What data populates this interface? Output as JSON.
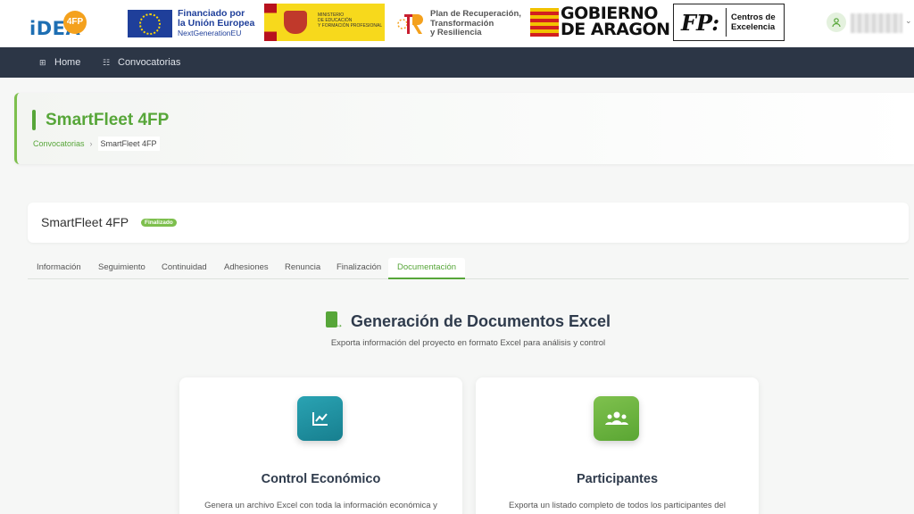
{
  "logos": {
    "idea_text": "iDEA",
    "idea_badge": "4FP",
    "eu_line1": "Financiado por",
    "eu_line2": "la Unión Europea",
    "eu_line3": "NextGenerationEU",
    "ministerio_line1": "MINISTERIO",
    "ministerio_line2": "DE EDUCACIÓN",
    "ministerio_line3": "Y FORMACIÓN PROFESIONAL",
    "prtr_line1": "Plan de Recuperación,",
    "prtr_line2": "Transformación",
    "prtr_line3": "y Resiliencia",
    "aragon_line1": "GOBIERNO",
    "aragon_line2": "DE ARAGON",
    "fp_mark": "FP:",
    "fp_line1": "Centros de",
    "fp_line2": "Excelencia"
  },
  "nav": {
    "home": "Home",
    "convocatorias": "Convocatorias"
  },
  "header": {
    "title": "SmartFleet 4FP",
    "breadcrumb_parent": "Convocatorias",
    "breadcrumb_current": "SmartFleet 4FP"
  },
  "project": {
    "title": "SmartFleet 4FP",
    "badge": "Finalizado"
  },
  "tabs": [
    {
      "label": "Información"
    },
    {
      "label": "Seguimiento"
    },
    {
      "label": "Continuidad"
    },
    {
      "label": "Adhesiones"
    },
    {
      "label": "Renuncia"
    },
    {
      "label": "Finalización"
    },
    {
      "label": "Documentación"
    }
  ],
  "active_tab": "Documentación",
  "documents": {
    "title": "Generación de Documentos Excel",
    "subtitle": "Exporta información del proyecto en formato Excel para análisis y control",
    "cards": [
      {
        "title": "Control Económico",
        "desc": "Genera un archivo Excel con toda la información económica y",
        "icon": "chart-line-icon"
      },
      {
        "title": "Participantes",
        "desc": "Exporta un listado completo de todos los participantes del",
        "icon": "users-icon"
      }
    ]
  },
  "colors": {
    "brand_green": "#57a639",
    "nav_bg": "#2c3646",
    "teal": "#1f93a3"
  }
}
